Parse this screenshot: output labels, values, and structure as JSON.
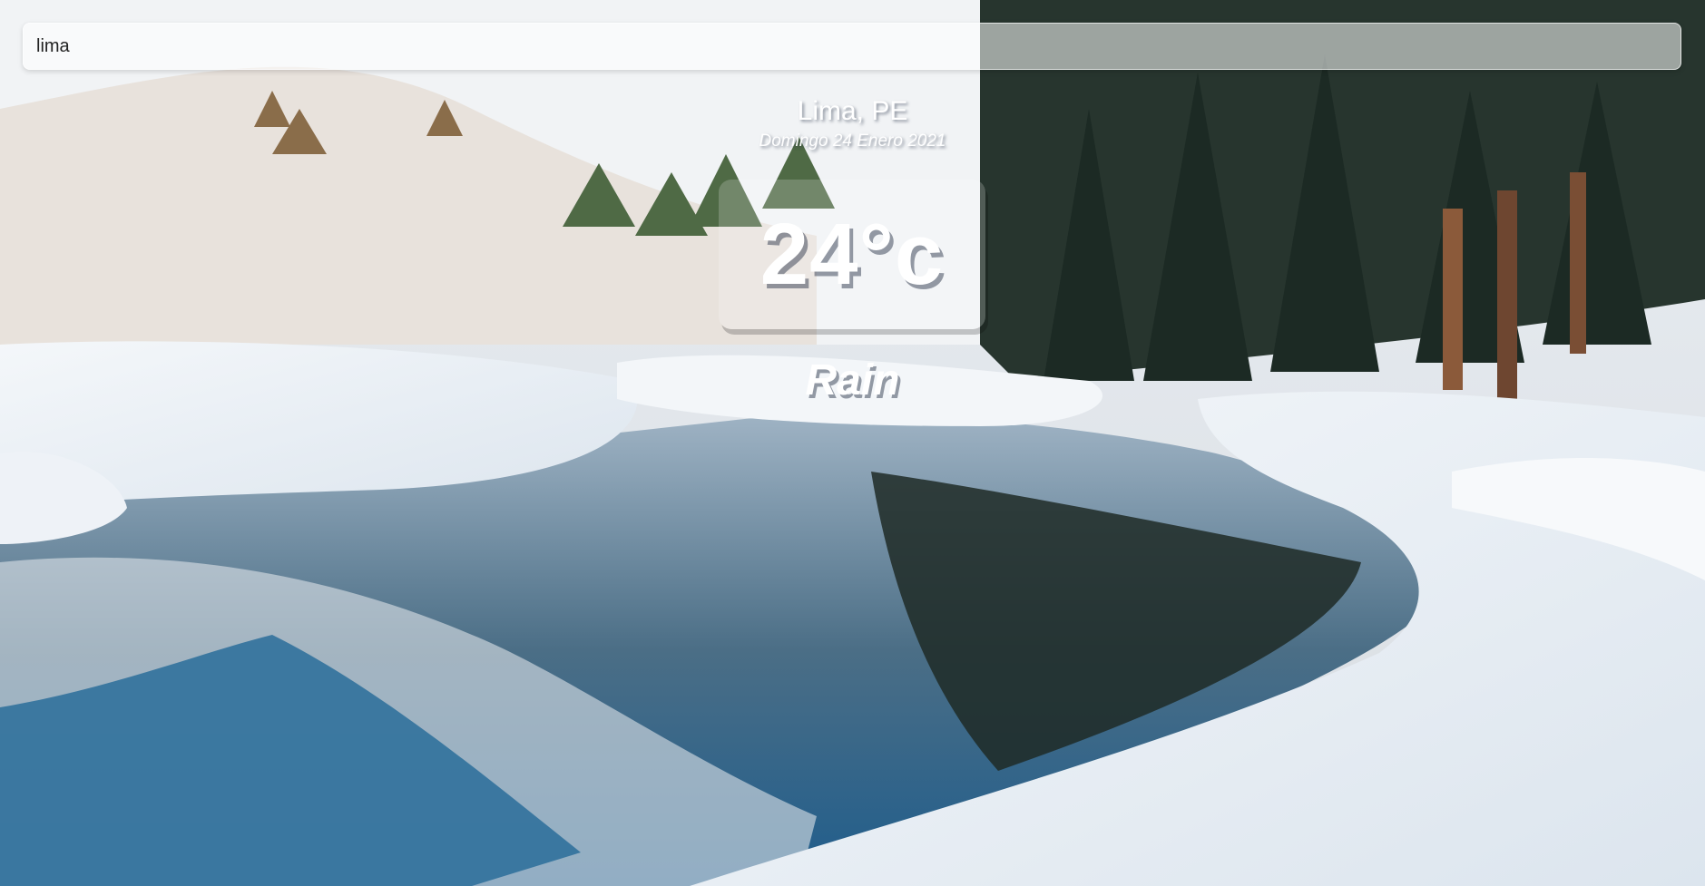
{
  "search": {
    "value": "lima",
    "placeholder": ""
  },
  "location": {
    "city_country": "Lima, PE",
    "date": "Domingo 24 Enero 2021"
  },
  "weather": {
    "temperature": "24°c",
    "condition": "Rain"
  },
  "background": {
    "scene": "snowy-mountain-lake",
    "sky_color": "#dfe6ee",
    "water_color": "#2a6d9a",
    "snow_color": "#eef3f8"
  }
}
